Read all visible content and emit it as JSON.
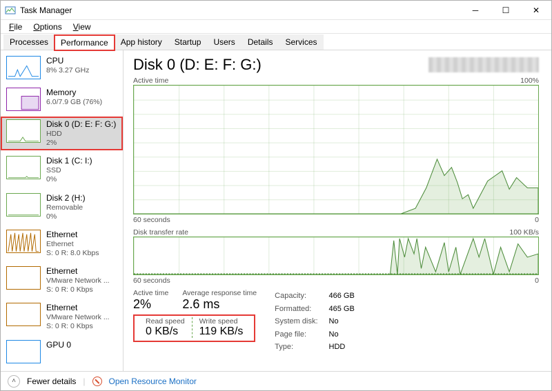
{
  "window": {
    "title": "Task Manager"
  },
  "menu": {
    "file": "File",
    "options": "Options",
    "view": "View"
  },
  "tabs": [
    "Processes",
    "Performance",
    "App history",
    "Startup",
    "Users",
    "Details",
    "Services"
  ],
  "active_tab_index": 1,
  "sidebar": [
    {
      "name": "CPU",
      "l2": "8% 3.27 GHz",
      "l3": "",
      "color": "#1e88e5"
    },
    {
      "name": "Memory",
      "l2": "6.0/7.9 GB (76%)",
      "l3": "",
      "color": "#8e24aa"
    },
    {
      "name": "Disk 0 (D: E: F: G:)",
      "l2": "HDD",
      "l3": "2%",
      "color": "#6aa84f"
    },
    {
      "name": "Disk 1 (C: I:)",
      "l2": "SSD",
      "l3": "0%",
      "color": "#6aa84f"
    },
    {
      "name": "Disk 2 (H:)",
      "l2": "Removable",
      "l3": "0%",
      "color": "#6aa84f"
    },
    {
      "name": "Ethernet",
      "l2": "Ethernet",
      "l3": "S: 0 R: 8.0 Kbps",
      "color": "#b26a00"
    },
    {
      "name": "Ethernet",
      "l2": "VMware Network ...",
      "l3": "S: 0 R: 0 Kbps",
      "color": "#b26a00"
    },
    {
      "name": "Ethernet",
      "l2": "VMware Network ...",
      "l3": "S: 0 R: 0 Kbps",
      "color": "#b26a00"
    },
    {
      "name": "GPU 0",
      "l2": "",
      "l3": "",
      "color": "#1e88e5"
    }
  ],
  "selected_index": 2,
  "detail": {
    "title": "Disk 0 (D: E: F: G:)",
    "chart1": {
      "label": "Active time",
      "max": "100%",
      "xaxis_left": "60 seconds",
      "xaxis_right": "0"
    },
    "chart2": {
      "label": "Disk transfer rate",
      "max": "100 KB/s",
      "xaxis_left": "60 seconds",
      "xaxis_right": "0"
    },
    "stats": {
      "active_time_label": "Active time",
      "active_time_value": "2%",
      "avg_resp_label": "Average response time",
      "avg_resp_value": "2.6 ms",
      "read_label": "Read speed",
      "read_value": "0 KB/s",
      "write_label": "Write speed",
      "write_value": "119 KB/s",
      "props": [
        {
          "l": "Capacity:",
          "v": "466 GB"
        },
        {
          "l": "Formatted:",
          "v": "465 GB"
        },
        {
          "l": "System disk:",
          "v": "No"
        },
        {
          "l": "Page file:",
          "v": "No"
        },
        {
          "l": "Type:",
          "v": "HDD"
        }
      ]
    }
  },
  "footer": {
    "fewer": "Fewer details",
    "orm": "Open Resource Monitor"
  },
  "chart_data": [
    {
      "type": "line",
      "title": "Active time",
      "ylabel": "%",
      "ylim": [
        0,
        100
      ],
      "x_seconds_ago": [
        60,
        55,
        50,
        45,
        40,
        35,
        30,
        25,
        20,
        17,
        15,
        13,
        12,
        11,
        10,
        9,
        8,
        7,
        5,
        3,
        2,
        1,
        0
      ],
      "values": [
        0,
        0,
        0,
        0,
        0,
        0,
        0,
        0,
        0,
        5,
        20,
        45,
        30,
        38,
        25,
        12,
        15,
        5,
        25,
        35,
        20,
        28,
        22
      ]
    },
    {
      "type": "line",
      "title": "Disk transfer rate",
      "ylabel": "KB/s",
      "ylim": [
        0,
        100
      ],
      "series": [
        {
          "name": "Read",
          "x_seconds_ago": [
            60,
            0
          ],
          "values": [
            0,
            0
          ]
        },
        {
          "name": "Write",
          "x_seconds_ago": [
            60,
            22,
            21,
            20,
            19,
            18,
            17,
            16,
            15,
            14,
            12,
            10,
            9,
            8,
            7,
            5,
            4,
            3,
            2,
            1,
            0
          ],
          "values": [
            0,
            0,
            95,
            100,
            30,
            100,
            60,
            100,
            20,
            70,
            10,
            80,
            5,
            60,
            0,
            100,
            40,
            90,
            0,
            60,
            50
          ]
        }
      ]
    }
  ]
}
